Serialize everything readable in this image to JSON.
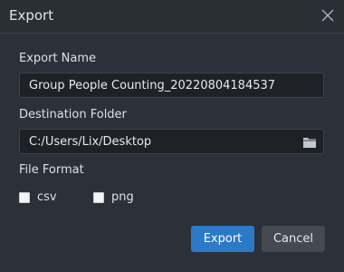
{
  "dialog": {
    "title": "Export",
    "close_icon": "close-icon"
  },
  "export_name": {
    "label": "Export Name",
    "value": "Group People Counting_20220804184537"
  },
  "destination": {
    "label": "Destination Folder",
    "value": "C:/Users/Lix/Desktop",
    "browse_icon": "folder-icon"
  },
  "file_format": {
    "label": "File Format",
    "options": [
      {
        "label": "csv",
        "checked": false
      },
      {
        "label": "png",
        "checked": false
      }
    ]
  },
  "actions": {
    "export_label": "Export",
    "cancel_label": "Cancel"
  },
  "colors": {
    "background": "#2c3038",
    "field_background": "#1e2126",
    "primary_button": "#2b79c7",
    "secondary_button": "#454a52"
  }
}
